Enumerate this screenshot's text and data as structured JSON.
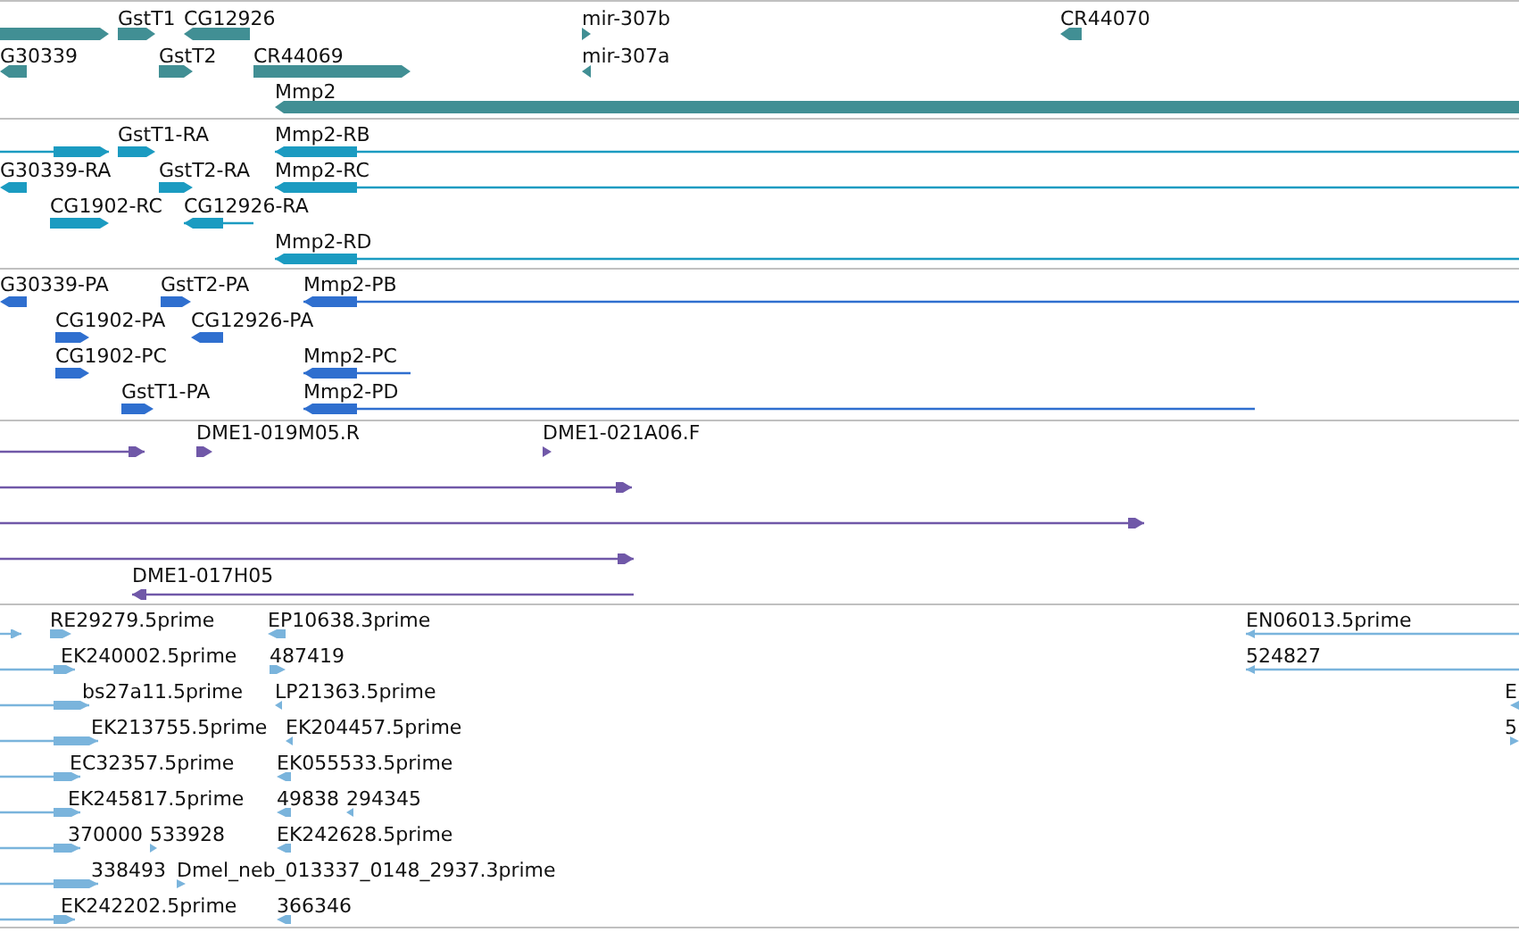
{
  "tracks": [
    {
      "kind": "gene",
      "color": "#418f94",
      "features": [
        {
          "reverse": false
        },
        {
          "label": "GstT1",
          "reverse": false
        },
        {
          "label": "CG12926",
          "reverse": true
        },
        {
          "label": "mir-307b",
          "reverse": false
        },
        {
          "label": "CR44070",
          "reverse": true
        },
        {
          "label": "G30339",
          "reverse": true
        },
        {
          "label": "GstT2",
          "reverse": false
        },
        {
          "label": "CR44069",
          "reverse": false
        },
        {
          "label": "mir-307a",
          "reverse": true
        },
        {
          "label": "Mmp2",
          "reverse": true
        }
      ]
    },
    {
      "kind": "transcript",
      "color": "#1b9bc1",
      "features": [
        {
          "reverse": false
        },
        {
          "label": "GstT1-RA",
          "reverse": false
        },
        {
          "label": "Mmp2-RB",
          "reverse": true
        },
        {
          "label": "G30339-RA",
          "reverse": true
        },
        {
          "label": "GstT2-RA",
          "reverse": false
        },
        {
          "label": "Mmp2-RC",
          "reverse": true
        },
        {
          "label": "CG1902-RC",
          "reverse": false
        },
        {
          "label": "CG12926-RA",
          "reverse": true
        },
        {
          "label": "Mmp2-RD",
          "reverse": true
        }
      ]
    },
    {
      "kind": "protein",
      "color": "#2f6fcf",
      "features": [
        {
          "label": "G30339-PA",
          "reverse": true
        },
        {
          "label": "GstT2-PA",
          "reverse": false
        },
        {
          "label": "Mmp2-PB",
          "reverse": true
        },
        {
          "label": "CG1902-PA",
          "reverse": false
        },
        {
          "label": "CG12926-PA",
          "reverse": true
        },
        {
          "label": "CG1902-PC",
          "reverse": false
        },
        {
          "label": "Mmp2-PC",
          "reverse": true
        },
        {
          "label": "GstT1-PA",
          "reverse": false
        },
        {
          "label": "Mmp2-PD",
          "reverse": true
        }
      ]
    },
    {
      "kind": "clone",
      "color": "#7058a8",
      "features": [
        {
          "reverse": false
        },
        {
          "label": "DME1-019M05.R",
          "reverse": false
        },
        {
          "label": "DME1-021A06.F",
          "reverse": false
        },
        {
          "reverse": false
        },
        {
          "reverse": false
        },
        {
          "reverse": false
        },
        {
          "label": "DME1-017H05",
          "reverse": true
        }
      ]
    },
    {
      "kind": "est",
      "color": "#7ab4dc",
      "features": [
        {
          "reverse": false
        },
        {
          "label": "RE29279.5prime",
          "reverse": false
        },
        {
          "label": "EP10638.3prime",
          "reverse": true
        },
        {
          "label": "EN06013.5prime",
          "reverse": true
        },
        {
          "label": "EK240002.5prime",
          "reverse": false
        },
        {
          "label": "487419",
          "reverse": false
        },
        {
          "label": "524827",
          "reverse": true
        },
        {
          "label": "bs27a11.5prime",
          "reverse": false
        },
        {
          "label": "LP21363.5prime",
          "reverse": true
        },
        {
          "label": "E",
          "reverse": true
        },
        {
          "label": "EK213755.5prime",
          "reverse": false
        },
        {
          "label": "EK204457.5prime",
          "reverse": true
        },
        {
          "label": "5",
          "reverse": false
        },
        {
          "label": "EC32357.5prime",
          "reverse": false
        },
        {
          "label": "EK055533.5prime",
          "reverse": true
        },
        {
          "label": "EK245817.5prime",
          "reverse": false
        },
        {
          "label": "49838",
          "reverse": true
        },
        {
          "label": "294345",
          "reverse": true
        },
        {
          "label": "370000",
          "reverse": false
        },
        {
          "label": "533928",
          "reverse": false
        },
        {
          "label": "EK242628.5prime",
          "reverse": true
        },
        {
          "label": "338493",
          "reverse": false
        },
        {
          "label": "Dmel_neb_013337_0148_2937.3prime",
          "reverse": false
        },
        {
          "label": "EK242202.5prime",
          "reverse": false
        },
        {
          "label": "366346",
          "reverse": true
        }
      ]
    }
  ]
}
